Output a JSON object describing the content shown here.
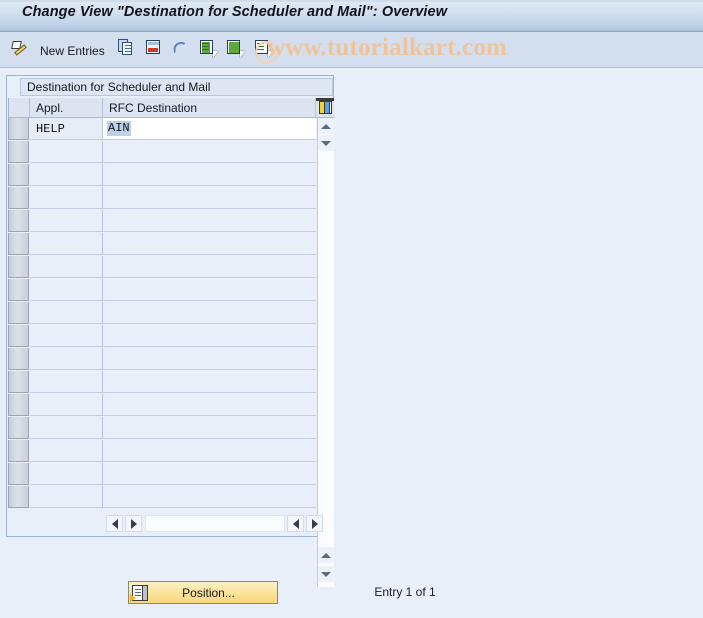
{
  "window": {
    "title": "Change View \"Destination for Scheduler and Mail\": Overview"
  },
  "toolbar": {
    "display_change_icon": "pencil-display-change-icon",
    "new_entries_label": "New Entries",
    "icons": [
      {
        "name": "copy-icon",
        "title": "Copy As..."
      },
      {
        "name": "delete-icon",
        "title": "Delete"
      },
      {
        "name": "undo-icon",
        "title": "Undo Change"
      },
      {
        "name": "select-all-icon",
        "title": "Select All"
      },
      {
        "name": "select-block-icon",
        "title": "Select Block"
      },
      {
        "name": "deselect-all-icon",
        "title": "Deselect All"
      }
    ]
  },
  "watermark": {
    "text": "www.tutorialkart.com",
    "color": "#f0c49a"
  },
  "table": {
    "caption": "Destination for Scheduler and Mail",
    "columns": [
      {
        "key": "appl",
        "label": "Appl."
      },
      {
        "key": "rfc",
        "label": "RFC Destination"
      }
    ],
    "config_icon": "table-settings-icon",
    "rows": [
      {
        "appl": "HELP",
        "rfc": "AIN",
        "selected": true
      },
      {
        "appl": "",
        "rfc": ""
      },
      {
        "appl": "",
        "rfc": ""
      },
      {
        "appl": "",
        "rfc": ""
      },
      {
        "appl": "",
        "rfc": ""
      },
      {
        "appl": "",
        "rfc": ""
      },
      {
        "appl": "",
        "rfc": ""
      },
      {
        "appl": "",
        "rfc": ""
      },
      {
        "appl": "",
        "rfc": ""
      },
      {
        "appl": "",
        "rfc": ""
      },
      {
        "appl": "",
        "rfc": ""
      },
      {
        "appl": "",
        "rfc": ""
      },
      {
        "appl": "",
        "rfc": ""
      },
      {
        "appl": "",
        "rfc": ""
      },
      {
        "appl": "",
        "rfc": ""
      },
      {
        "appl": "",
        "rfc": ""
      },
      {
        "appl": "",
        "rfc": ""
      }
    ]
  },
  "scrollbars": {
    "v_up_icon": "scroll-up-icon",
    "v_down_icon": "scroll-down-icon",
    "h_left_icon": "scroll-left-icon",
    "h_right_icon": "scroll-right-icon"
  },
  "footer": {
    "position_button_label": "Position...",
    "position_button_icon": "position-icon",
    "entry_status": "Entry 1 of 1"
  },
  "colors": {
    "page_background": "#e9eff8",
    "titlebar_gradient_top": "#e2ebf6",
    "titlebar_gradient_bottom": "#a8bfdb",
    "toolbar_background": "#d3dfee",
    "table_border": "#9bb4d0",
    "button_yellow": "#f9e09a",
    "selection_blue": "#bcd2e8"
  }
}
